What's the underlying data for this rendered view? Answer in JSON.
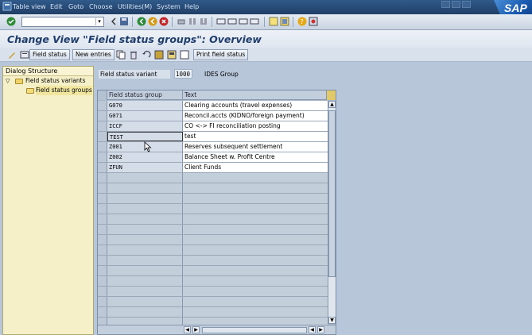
{
  "menubar": {
    "items": [
      "Table view",
      "Edit",
      "Goto",
      "Choose",
      "Utilities(M)",
      "System",
      "Help"
    ],
    "logo": "SAP"
  },
  "stdbar": {
    "command_field_value": "",
    "icons": [
      "enter-icon",
      "save-icon",
      "back-icon",
      "exit-icon",
      "cancel-icon",
      "print-icon",
      "find-icon",
      "find-next-icon",
      "first-page-icon",
      "previous-page-icon",
      "next-page-icon",
      "last-page-icon",
      "create-session-icon",
      "shortcut-icon",
      "help-icon",
      "customize-layout-icon"
    ]
  },
  "title": "Change View \"Field status groups\": Overview",
  "appbar": {
    "field_status_label": "Field status",
    "new_entries_label": "New entries",
    "print_field_status_label": "Print field status"
  },
  "dialog_structure": {
    "heading": "Dialog Structure",
    "items": [
      {
        "label": "Field status variants",
        "level": 0,
        "expanded": true
      },
      {
        "label": "Field status groups",
        "level": 1,
        "selected": true
      }
    ]
  },
  "variant": {
    "label": "Field status variant",
    "value": "1000",
    "description": "IDES Group"
  },
  "table": {
    "columns": [
      "Field status group",
      "Text"
    ],
    "rows": [
      {
        "group": "G070",
        "text": "Clearing accounts (travel expenses)"
      },
      {
        "group": "G071",
        "text": "Reconcil.accts (KIDNO/foreign payment)"
      },
      {
        "group": "ICCF",
        "text": "CO <-> FI reconciliation posting"
      },
      {
        "group": "TEST",
        "text": "test"
      },
      {
        "group": "Z001",
        "text": "Reserves subsequent settlement"
      },
      {
        "group": "Z002",
        "text": "Balance Sheet w. Profit Centre"
      },
      {
        "group": "ZFUN",
        "text": "Client Funds"
      }
    ],
    "empty_rows": 15
  },
  "colors": {
    "menubar": "#213f66",
    "title_text": "#1e3c6b",
    "background": "#b7c6d9",
    "dialog_panel": "#f5f0c8"
  }
}
